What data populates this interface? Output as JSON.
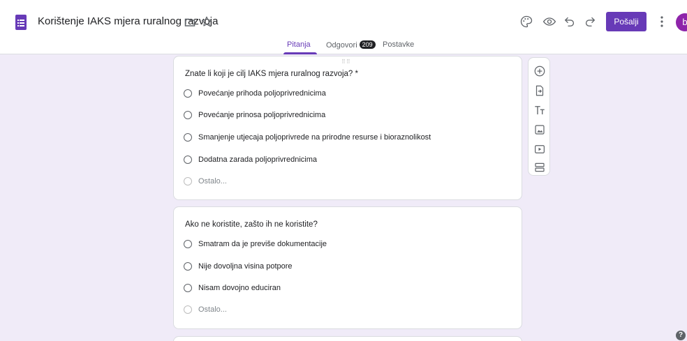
{
  "header": {
    "title": "Korištenje IAKS mjera ruralnog razvoja",
    "send_label": "Pošalji",
    "avatar_initial": "b"
  },
  "tabs": [
    {
      "label": "Pitanja",
      "active": true
    },
    {
      "label": "Odgovori",
      "badge": "209"
    },
    {
      "label": "Postavke"
    }
  ],
  "questions": [
    {
      "text": "Znate li koji je cilj IAKS mjera ruralnog razvoja? *",
      "options": [
        "Povećanje prihoda poljoprivrednicima",
        "Povećanje prinosa poljoprivrednicima",
        "Smanjenje utjecaja poljoprivrede na prirodne resurse i bioraznolikost",
        "Dodatna zarada poljoprivrednicima"
      ],
      "other_label": "Ostalo..."
    },
    {
      "text": "Ako ne koristite, zašto ih ne koristite?",
      "options": [
        "Smatram da je previše dokumentacije",
        "Nije dovoljna visina potpore",
        "Nisam dovojno educiran"
      ],
      "other_label": "Ostalo..."
    }
  ],
  "side_toolbar_tools": [
    "add-question",
    "import-questions",
    "add-title",
    "add-image",
    "add-video",
    "add-section"
  ],
  "colors": {
    "accent": "#673ab7",
    "background": "#f0ebf8",
    "card": "#ffffff"
  }
}
